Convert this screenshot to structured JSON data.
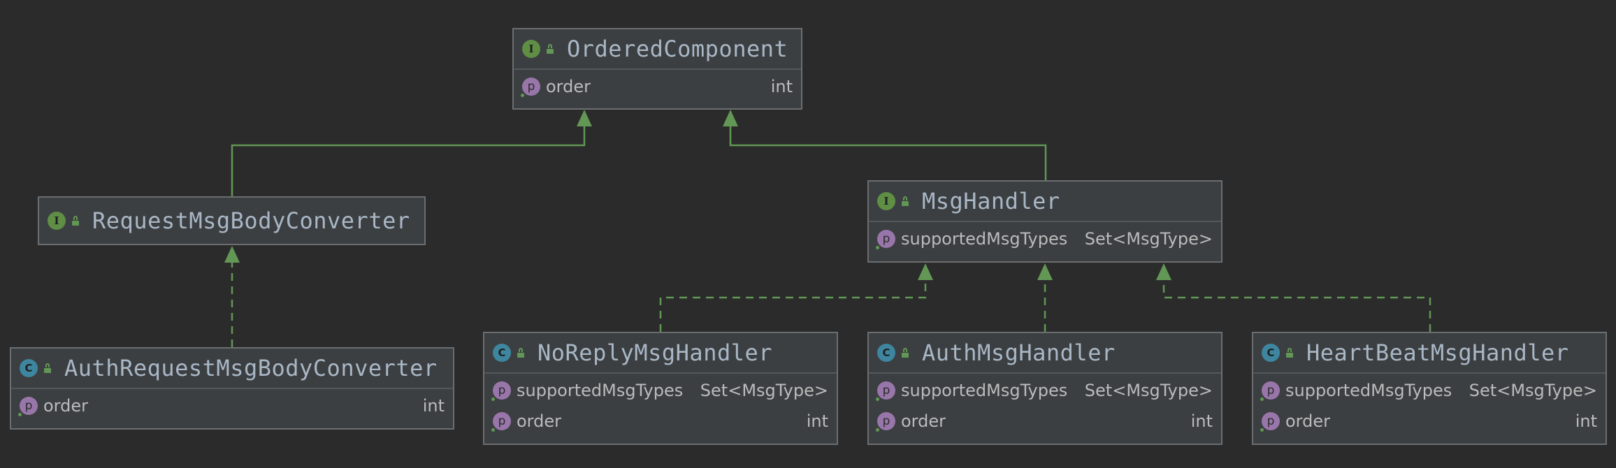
{
  "diagram": {
    "nodes": [
      {
        "id": "ordered-component",
        "kind": "interface",
        "badge": "I",
        "name": "OrderedComponent",
        "fields": [
          {
            "badge": "p",
            "name": "order",
            "type": "int"
          }
        ]
      },
      {
        "id": "request-msg-body-converter",
        "kind": "interface",
        "badge": "I",
        "name": "RequestMsgBodyConverter",
        "fields": []
      },
      {
        "id": "msg-handler",
        "kind": "interface",
        "badge": "I",
        "name": "MsgHandler",
        "fields": [
          {
            "badge": "p",
            "name": "supportedMsgTypes",
            "type": "Set<MsgType>"
          }
        ]
      },
      {
        "id": "auth-request-msg-body-converter",
        "kind": "class",
        "badge": "C",
        "name": "AuthRequestMsgBodyConverter",
        "fields": [
          {
            "badge": "p",
            "name": "order",
            "type": "int"
          }
        ]
      },
      {
        "id": "no-reply-msg-handler",
        "kind": "class",
        "badge": "C",
        "name": "NoReplyMsgHandler",
        "fields": [
          {
            "badge": "p",
            "name": "supportedMsgTypes",
            "type": "Set<MsgType>"
          },
          {
            "badge": "p",
            "name": "order",
            "type": "int"
          }
        ]
      },
      {
        "id": "auth-msg-handler",
        "kind": "class",
        "badge": "C",
        "name": "AuthMsgHandler",
        "fields": [
          {
            "badge": "p",
            "name": "supportedMsgTypes",
            "type": "Set<MsgType>"
          },
          {
            "badge": "p",
            "name": "order",
            "type": "int"
          }
        ]
      },
      {
        "id": "heart-beat-msg-handler",
        "kind": "class",
        "badge": "C",
        "name": "HeartBeatMsgHandler",
        "fields": [
          {
            "badge": "p",
            "name": "supportedMsgTypes",
            "type": "Set<MsgType>"
          },
          {
            "badge": "p",
            "name": "order",
            "type": "int"
          }
        ]
      }
    ],
    "edges": [
      {
        "from": "request-msg-body-converter",
        "to": "ordered-component",
        "kind": "extends"
      },
      {
        "from": "msg-handler",
        "to": "ordered-component",
        "kind": "extends"
      },
      {
        "from": "auth-request-msg-body-converter",
        "to": "request-msg-body-converter",
        "kind": "implements"
      },
      {
        "from": "no-reply-msg-handler",
        "to": "msg-handler",
        "kind": "implements"
      },
      {
        "from": "auth-msg-handler",
        "to": "msg-handler",
        "kind": "implements"
      },
      {
        "from": "heart-beat-msg-handler",
        "to": "msg-handler",
        "kind": "implements"
      }
    ],
    "colors": {
      "background": "#2b2b2b",
      "node_fill": "#3c3f41",
      "node_border": "#6b6e70",
      "edge": "#629755",
      "interface_badge": "#5f8e45",
      "class_badge": "#3e86a0",
      "property_badge": "#9876aa",
      "title_text": "#a9b7c6",
      "field_text": "#bbbbbb"
    }
  }
}
